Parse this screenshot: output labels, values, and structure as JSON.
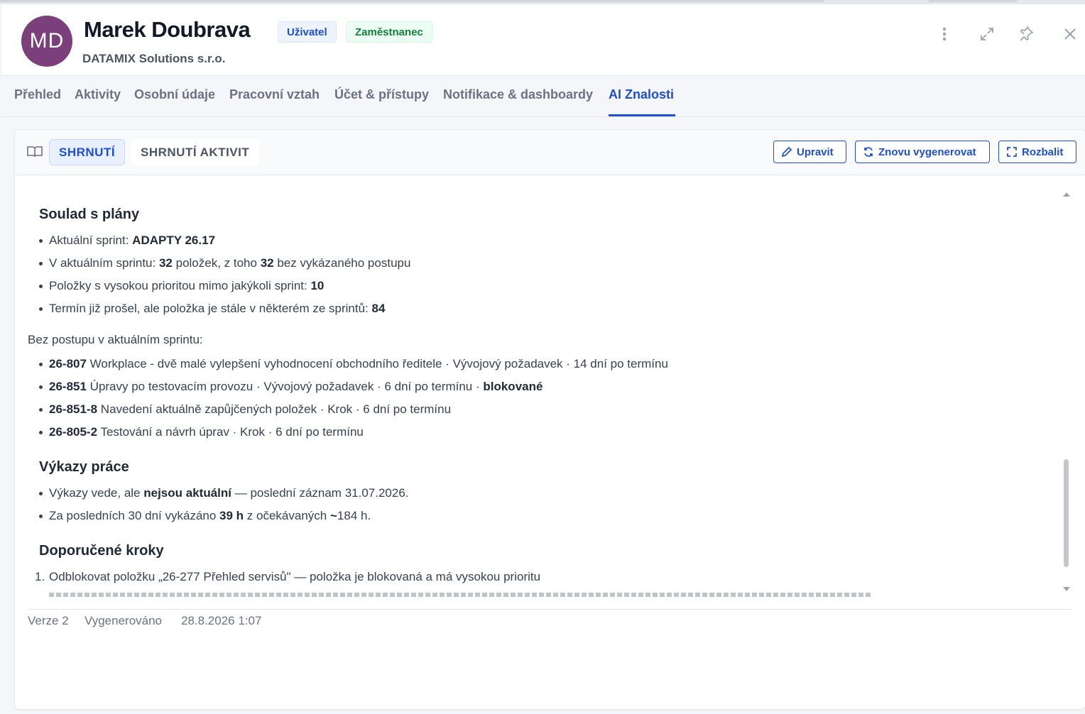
{
  "person": {
    "initials": "MD",
    "name": "Marek Doubrava",
    "company": "DATAMIX Solutions s.r.o.",
    "badges": {
      "user": "Uživatel",
      "employee": "Zaměstnanec"
    }
  },
  "header_icons": [
    "more-vertical-icon",
    "expand-icon",
    "pin-icon",
    "close-icon"
  ],
  "tabs": [
    {
      "label": "Přehled"
    },
    {
      "label": "Aktivity"
    },
    {
      "label": "Osobní údaje"
    },
    {
      "label": "Pracovní vztah"
    },
    {
      "label": "Účet & přístupy"
    },
    {
      "label": "Notifikace & dashboardy"
    },
    {
      "label": "AI Znalosti",
      "active": true
    }
  ],
  "subtabs": {
    "summary": "SHRNUTÍ",
    "activity_summary": "SHRNUTÍ AKTIVIT"
  },
  "actions": {
    "edit": "Upravit",
    "regenerate": "Znovu vygenerovat",
    "expand": "Rozbalit"
  },
  "content": {
    "s1": {
      "title": "Soulad s plány",
      "i1": {
        "pre": "Aktuální sprint: ",
        "b": "ADAPTY 26.17"
      },
      "i2": {
        "pre": "V aktuálním sprintu: ",
        "b1": "32",
        "mid": " položek, z toho ",
        "b2": "32",
        "post": " bez vykázaného postupu"
      },
      "i3": {
        "pre": "Položky s vysokou prioritou mimo jakýkoli sprint: ",
        "b": "10"
      },
      "i4": {
        "pre": "Termín již prošel, ale položka je stále v některém ze sprintů: ",
        "b": "84"
      }
    },
    "para": "Bez postupu v aktuálním sprintu:",
    "items": [
      {
        "id": "26-807",
        "text": " Workplace - dvě malé vylepšení vyhodnocení obchodního ředitele · Vývojový požadavek · 14 dní po termínu",
        "extra": ""
      },
      {
        "id": "26-851",
        "text": " Úpravy po testovacím provozu · Vývojový požadavek · 6 dní po termínu · ",
        "extra": "blokované"
      },
      {
        "id": "26-851-8",
        "text": " Navedení aktuálně zapůjčených položek · Krok · 6 dní po termínu",
        "extra": ""
      },
      {
        "id": "26-805-2",
        "text": " Testování a návrh úprav · Krok · 6 dní po termínu",
        "extra": ""
      }
    ],
    "s2": {
      "title": "Výkazy práce",
      "i1": {
        "pre": "Výkazy vede, ale ",
        "b": "nejsou aktuální",
        "post": " — poslední záznam 31.07.2026."
      },
      "i2": {
        "pre": "Za posledních 30 dní vykázáno ",
        "b1": "39 h",
        "mid": " z očekávaných ",
        "b2": "~",
        "post": "184 h."
      }
    },
    "s3": {
      "title": "Doporučené kroky",
      "n1": "1.",
      "i1": "Odblokovat položku „26-277 Přehled servisů\" — položka je blokovaná a má vysokou prioritu"
    }
  },
  "footer": {
    "version": "Verze 2",
    "generated_label": "Vygenerováno",
    "generated_at": "28.8.2026 1:07"
  }
}
